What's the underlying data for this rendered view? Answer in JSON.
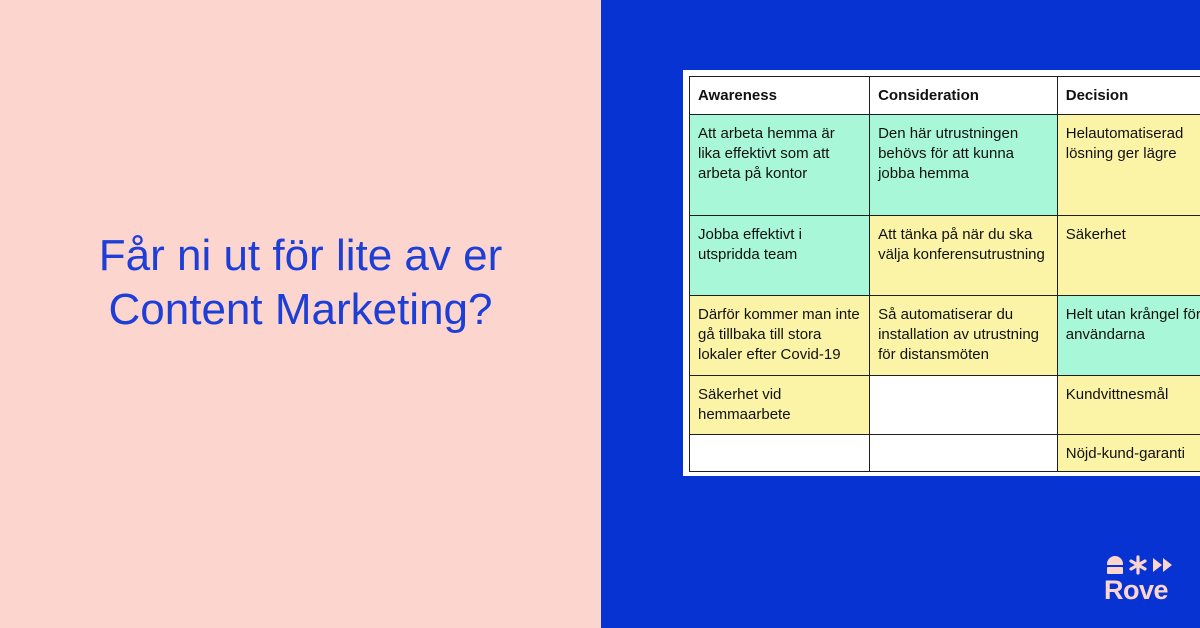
{
  "headline": {
    "line1": "Får ni ut för lite av er",
    "line2": "Content Marketing?"
  },
  "table": {
    "headers": [
      "Awareness",
      "Consideration",
      "Decision"
    ],
    "rows": [
      [
        "Att arbeta hemma är lika effektivt som att arbeta på kontor",
        "Den här utrustningen behövs för att kunna jobba hemma",
        "Helautomatiserad lösning ger lägre"
      ],
      [
        "Jobba effektivt i utspridda team",
        "Att tänka på när du ska välja konferensutrustning",
        "Säkerhet"
      ],
      [
        "Därför kommer man inte gå tillbaka till stora lokaler efter Covid-19",
        "Så automatiserar du installation av utrustning för distansmöten",
        "Helt utan krångel för användarna"
      ],
      [
        "Säkerhet vid hemmaarbete",
        "",
        "Kundvittnesmål"
      ],
      [
        "",
        "",
        "Nöjd-kund-garanti"
      ]
    ],
    "colors": {
      "green": "#a9f7d9",
      "yellow": "#fbf3a6",
      "white": "#ffffff"
    }
  },
  "brand": {
    "name": "Rove",
    "icons": [
      "person-icon",
      "asterisk-icon",
      "fast-forward-icon"
    ],
    "color": "#fdd5cf"
  },
  "colors": {
    "left_background": "#fdd5cf",
    "right_background": "#0633d1",
    "headline": "#1d3fd6"
  }
}
